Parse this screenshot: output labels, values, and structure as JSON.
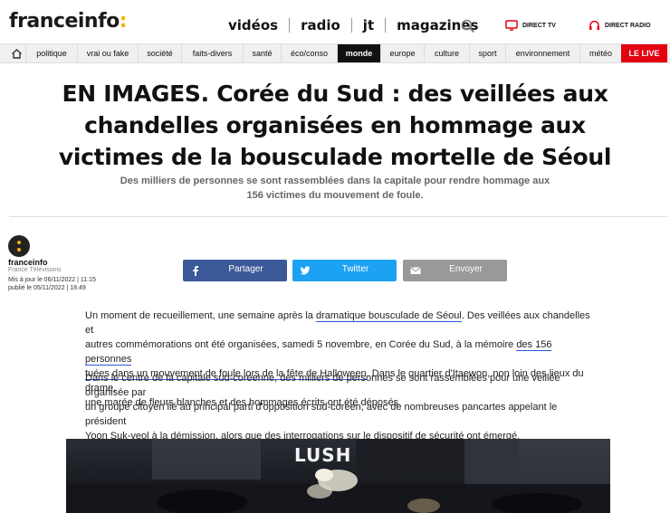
{
  "header": {
    "logo_main": "franceinfo",
    "logo_colon": ":",
    "nav": [
      "vidéos",
      "radio",
      "jt",
      "magazines"
    ],
    "direct_tv": "DIRECT TV",
    "direct_radio": "DIRECT RADIO"
  },
  "categories": [
    "politique",
    "vrai ou fake",
    "société",
    "faits-divers",
    "santé",
    "éco/conso",
    "monde",
    "europe",
    "culture",
    "sport",
    "environnement",
    "météo"
  ],
  "active_category": "monde",
  "live_label": "LE LIVE",
  "article": {
    "title_lines": [
      "EN IMAGES. Corée du Sud : des veillées aux",
      "chandelles organisées en hommage aux",
      "victimes de la bousculade mortelle de Séoul"
    ],
    "subtitle_lines": [
      "Des milliers de personnes se sont rassemblées dans la capitale pour rendre hommage aux",
      "156 victimes du mouvement de foule."
    ],
    "author": "franceinfo",
    "source": "France Télévisions",
    "updated": "Mis à jour le 06/11/2022 | 11:15",
    "published": "publié le 05/11/2022 | 18:49"
  },
  "share": {
    "facebook": "Partager",
    "twitter": "Twitter",
    "email": "Envoyer"
  },
  "paragraph1": {
    "line1_a": "Un moment de recueillement, une semaine après la ",
    "line1_link": "dramatique bousculade de Séoul",
    "line1_b": ". Des veillées aux chandelles et",
    "line2_a": "autres commémorations ont été organisées, samedi 5 novembre, en Corée du Sud, à la mémoire ",
    "line2_link": "des 156 personnes",
    "line3_link": "tuées dans un mouvement de foule lors de la fête de Halloween",
    "line3_b": ". Dans le quartier d'Itaewon, non loin des lieux du drame,",
    "line4": "une marée de fleurs blanches et des hommages écrits ont été déposés."
  },
  "paragraph2": {
    "line1": "Dans le centre de la capitale sud-coréenne, des milliers de personnes se sont rassemblées pour une veillée organisée par",
    "line2": "un groupe citoyen lié au principal parti d'opposition sud-coréen, avec de nombreuses pancartes appelant le président",
    "line3_a": "Yoon Suk-yeol à la démission, alors que ",
    "line3_link": "des interrogations sur le dispositif de sécurité ont émergé",
    "line3_b": "."
  },
  "photo": {
    "sign_text": "LUSH"
  },
  "colors": {
    "brand_yellow": "#f2b500",
    "live_red": "#e3000f",
    "facebook": "#3b5998",
    "twitter": "#1da1f2",
    "email": "#999999",
    "link_underline": "#2b57d8"
  }
}
